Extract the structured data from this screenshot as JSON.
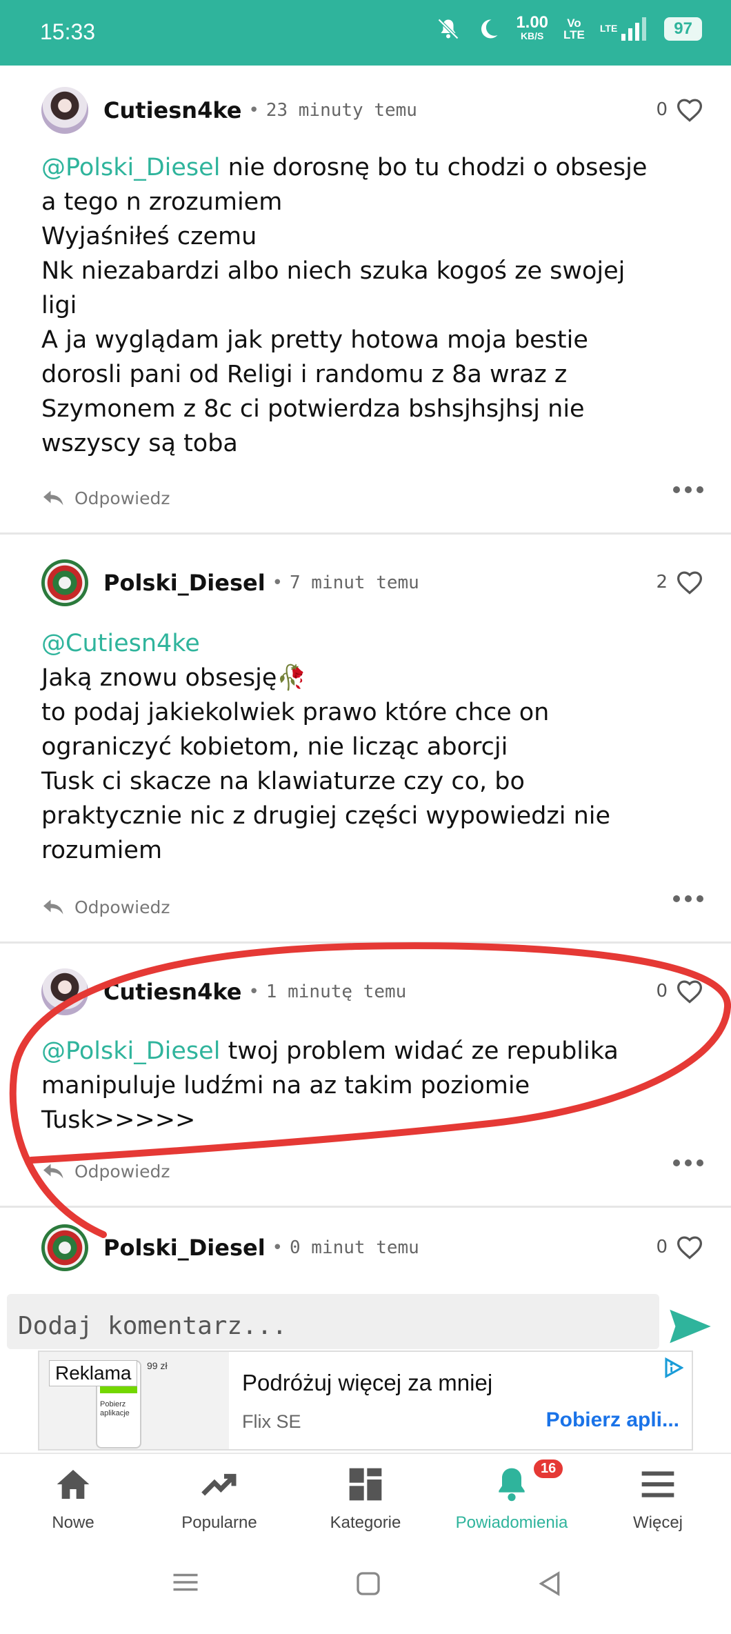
{
  "status_bar": {
    "time": "15:33",
    "net_speed_value": "1.00",
    "net_speed_unit": "KB/S",
    "volte_top": "Vo",
    "volte_bottom": "LTE",
    "lte": "LTE",
    "battery": "97"
  },
  "comments": [
    {
      "user": "Cutiesn4ke",
      "time": "23 minuty temu",
      "likes": "0",
      "mention": "@Polski_Diesel",
      "text": " nie dorosnę bo tu chodzi o obsesje\na tego n zrozumiem\nWyjaśniłeś czemu\nNk niezabardzi albo niech szuka kogoś ze swojej\nligi\nA ja wyglądam jak pretty hotowa moja bestie\ndorosli pani od Religi i randomu z 8a wraz z\nSzymonem z 8c ci potwierdza bshsjhsjhsj nie\nwszyscy są toba",
      "reply": "Odpowiedz"
    },
    {
      "user": "Polski_Diesel",
      "time": "7 minut temu",
      "likes": "2",
      "mention": "@Cutiesn4ke",
      "text": "\nJaką znowu obsesję🥀\nto podaj jakiekolwiek prawo które chce on\nograniczyć kobietom, nie licząc aborcji\nTusk ci skacze na klawiaturze czy co, bo\npraktycznie nic z drugiej części wypowiedzi nie\nrozumiem",
      "reply": "Odpowiedz"
    },
    {
      "user": "Cutiesn4ke",
      "time": "1 minutę temu",
      "likes": "0",
      "mention": "@Polski_Diesel",
      "text": " twoj problem widać ze republika\nmanipuluje ludźmi na az takim poziomie\nTusk>>>>>",
      "reply": "Odpowiedz"
    },
    {
      "user": "Polski_Diesel",
      "time": "0 minut temu",
      "likes": "0"
    }
  ],
  "comment_input": {
    "placeholder": "Dodaj komentarz..."
  },
  "ad": {
    "badge": "Reklama",
    "price": "99 zł",
    "mini_text": "Pobierz aplikacje",
    "title": "Podróżuj więcej za mniej",
    "brand": "Flix SE",
    "cta": "Pobierz apli..."
  },
  "bottom_nav": {
    "items": [
      {
        "label": "Nowe",
        "icon": "home-icon"
      },
      {
        "label": "Popularne",
        "icon": "trending-icon"
      },
      {
        "label": "Kategorie",
        "icon": "grid-icon"
      },
      {
        "label": "Powiadomienia",
        "icon": "bell-icon"
      },
      {
        "label": "Więcej",
        "icon": "menu-icon"
      }
    ],
    "notification_count": "16"
  },
  "colors": {
    "accent": "#2fb49c",
    "annotation": "#e53935",
    "cta": "#1a73e8"
  }
}
